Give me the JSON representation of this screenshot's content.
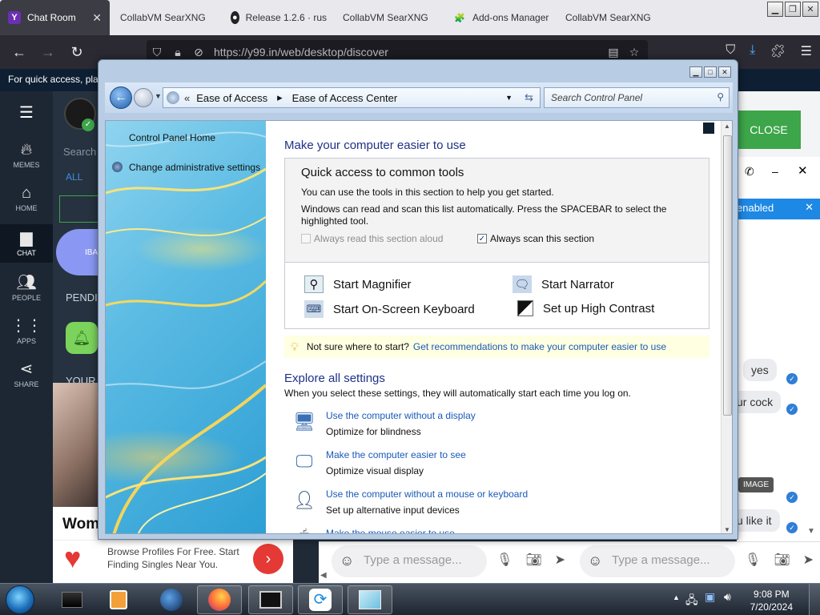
{
  "browser": {
    "tabs": [
      {
        "label": "Chat Room",
        "icon": "Y",
        "active": true
      },
      {
        "label": "CollabVM SearXNG",
        "icon": ""
      },
      {
        "label": "Release 1.2.6 · rus",
        "icon": "github"
      },
      {
        "label": "CollabVM SearXNG",
        "icon": ""
      },
      {
        "label": "Add-ons Manager",
        "icon": "puzzle"
      },
      {
        "label": "CollabVM SearXNG",
        "icon": ""
      }
    ],
    "url": "https://y99.in/web/desktop/discover",
    "window_buttons": [
      "minimize",
      "maximize",
      "close"
    ]
  },
  "webpage": {
    "notice": "For quick access, plac",
    "sidebar": [
      {
        "label": "MEMES",
        "icon": "fire-icon"
      },
      {
        "label": "HOME",
        "icon": "home-icon"
      },
      {
        "label": "CHAT",
        "icon": "chat-icon"
      },
      {
        "label": "PEOPLE",
        "icon": "people-icon"
      },
      {
        "label": "APPS",
        "icon": "apps-icon"
      },
      {
        "label": "SHARE",
        "icon": "share-icon"
      }
    ],
    "partial": {
      "search": "Search",
      "all": "ALL",
      "pending": "PENDI",
      "your": "YOUR",
      "avatar_text": "IBA"
    },
    "close_button": "CLOSE",
    "enabled_text": "enabled",
    "messages": [
      {
        "text": "yes"
      },
      {
        "text": "ur cock"
      },
      {
        "text": "IMAGE"
      },
      {
        "text": "u like it"
      }
    ],
    "message_placeholder": "Type a message...",
    "ad": {
      "title": "Wome",
      "text": "Browse Profiles For Free. Start Finding Singles Near You.",
      "arrow": "›"
    }
  },
  "control_panel": {
    "breadcrumb": [
      "Ease of Access",
      "Ease of Access Center"
    ],
    "search_placeholder": "Search Control Panel",
    "left_links": [
      "Control Panel Home",
      "Change administrative settings"
    ],
    "heading": "Make your computer easier to use",
    "quick": {
      "title": "Quick access to common tools",
      "line1": "You can use the tools in this section to help you get started.",
      "line2": "Windows can read and scan this list automatically.  Press the SPACEBAR to select the highlighted tool.",
      "check_read": "Always read this section aloud",
      "check_scan": "Always scan this section",
      "check_read_value": false,
      "check_scan_value": true,
      "tools": [
        {
          "label": "Start Magnifier",
          "icon": "magnifier-icon"
        },
        {
          "label": "Start Narrator",
          "icon": "narrator-icon"
        },
        {
          "label": "Start On-Screen Keyboard",
          "icon": "keyboard-icon"
        },
        {
          "label": "Set up High Contrast",
          "icon": "contrast-icon"
        }
      ]
    },
    "tip_text": "Not sure where to start?",
    "tip_link": "Get recommendations to make your computer easier to use",
    "explore_heading": "Explore all settings",
    "explore_sub": "When you select these settings, they will automatically start each time you log on.",
    "settings": [
      {
        "link": "Use the computer without a display",
        "desc": "Optimize for blindness",
        "icon": "display-icon"
      },
      {
        "link": "Make the computer easier to see",
        "desc": "Optimize visual display",
        "icon": "monitor-icon"
      },
      {
        "link": "Use the computer without a mouse or keyboard",
        "desc": "Set up alternative input devices",
        "icon": "person-icon"
      },
      {
        "link": "Make the mouse easier to use",
        "desc": "",
        "icon": "mouse-icon"
      }
    ]
  },
  "taskbar": {
    "time": "9:08 PM",
    "date": "7/20/2024"
  },
  "colors": {
    "accent_green": "#3da54a",
    "link_blue": "#1a5ab8",
    "heading_blue": "#1e3287"
  }
}
